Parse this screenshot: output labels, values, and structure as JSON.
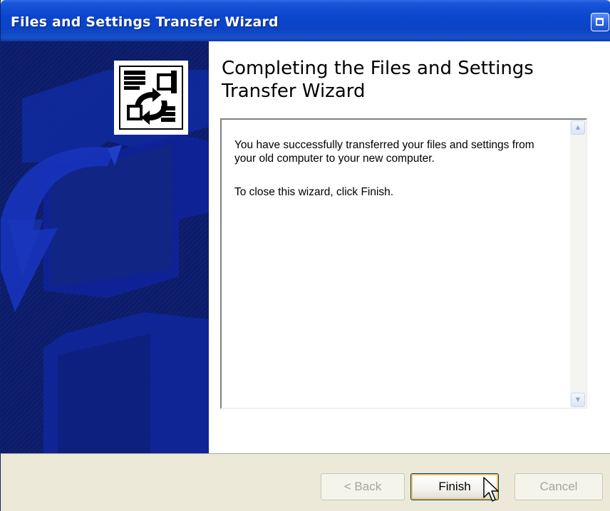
{
  "window": {
    "title": "Files and Settings Transfer Wizard"
  },
  "main": {
    "heading": "Completing the Files and Settings Transfer Wizard",
    "message": {
      "paragraph1": "You have successfully transferred your files and settings from your old computer to your new computer.",
      "paragraph2": "To close this wizard, click Finish."
    }
  },
  "buttons": {
    "back_label": "< Back",
    "finish_label": "Finish",
    "cancel_label": "Cancel"
  },
  "icons": {
    "title_button": "restore-window-icon",
    "wizard_logo": "files-settings-transfer-icon",
    "scroll_up": "scroll-up-arrow-icon",
    "scroll_down": "scroll-down-arrow-icon",
    "cursor": "mouse-pointer-icon"
  },
  "colors": {
    "titlebar": "#0a46cc",
    "sidebar": "#0d1e6e",
    "button_face": "#ece9d8",
    "default_button_focus": "#f4c660"
  }
}
